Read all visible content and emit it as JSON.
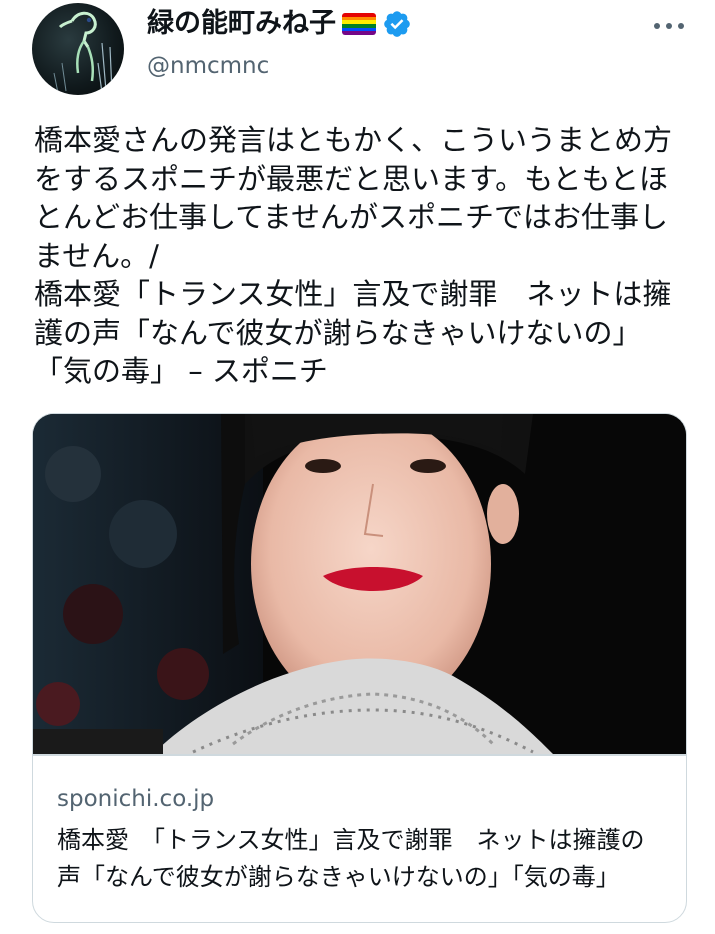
{
  "author": {
    "display_name": "緑の能町みね子",
    "handle": "@nmcmnc",
    "avatar_icon": "avatar-image",
    "verified_icon": "verified-badge-icon",
    "flag_icon": "rainbow-flag-icon",
    "verified_color": "#1d9bf0"
  },
  "menu": {
    "more_icon": "more-options-icon"
  },
  "tweet": {
    "text_line_1": "橋本愛さんの発言はともかく、こういうまとめ方をするスポニチが最悪だと思います。もともとほとんどお仕事してませんがスポニチではお仕事しません。/",
    "text_line_2": "橋本愛「トランス女性」言及で謝罪　ネットは擁護の声「なんで彼女が謝らなきゃいけないの」「気の毒」 – スポニチ"
  },
  "card": {
    "domain": "sponichi.co.jp",
    "title": "橋本愛　「トランス女性」言及で謝罪　ネットは擁護の声「なんで彼女が謝らなきゃいけないの」「気の毒」"
  },
  "colors": {
    "text": "#0f1419",
    "secondary": "#536471",
    "border": "#cfd9de"
  }
}
